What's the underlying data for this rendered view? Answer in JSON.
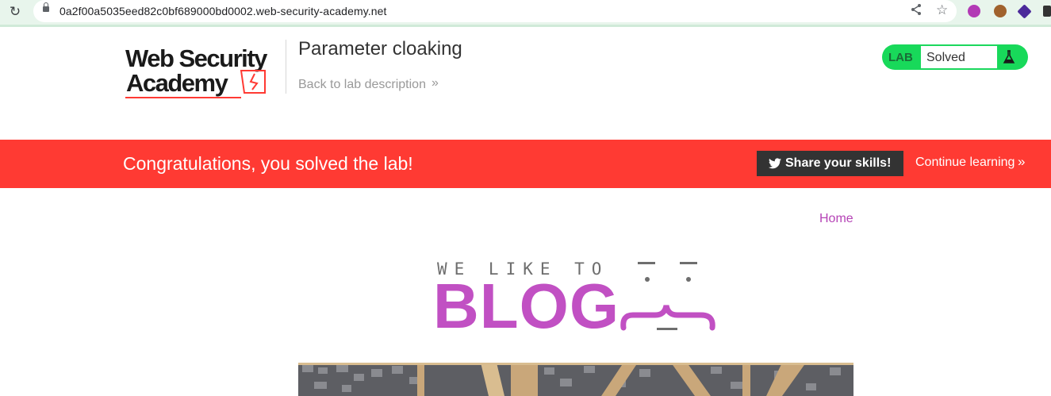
{
  "browser": {
    "url": "0a2f00a5035eed82c0bf689000bd0002.web-security-academy.net"
  },
  "academy": {
    "logo_line1": "Web Security",
    "logo_line2": "Academy",
    "lab_title": "Parameter cloaking",
    "back_link": "Back to lab description",
    "status_label": "LAB",
    "status_value": "Solved"
  },
  "banner": {
    "message": "Congratulations, you solved the lab!",
    "share_button": "Share your skills!",
    "continue_link": "Continue learning"
  },
  "blog": {
    "nav_home": "Home",
    "tagline": "WE LIKE TO",
    "wordmark": "BLOG"
  },
  "colors": {
    "banner_bg": "#ff3a33",
    "status_green": "#18d95a",
    "accent_purple": "#c150c3",
    "link_purple": "#b543b6"
  }
}
